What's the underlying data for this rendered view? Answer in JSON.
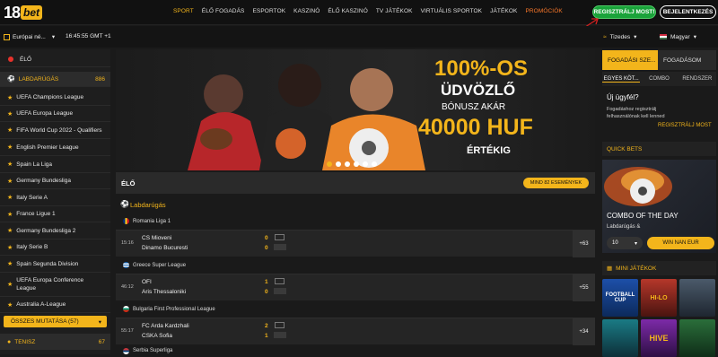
{
  "logo": {
    "number": "18",
    "brand": "bet"
  },
  "nav": {
    "items": [
      "SPORT",
      "ÉLŐ FOGADÁS",
      "ESPORTOK",
      "KASZINÓ",
      "ÉLŐ KASZINÓ",
      "TV JÁTÉKOK",
      "VIRTUÁLIS SPORTOK",
      "JÁTÉKOK",
      "PROMÓCIÓK"
    ],
    "active": "SPORT",
    "register": "REGISZTRÁLJ MOST!",
    "login": "BEJELENTKEZÉS"
  },
  "subbar": {
    "timezone": "Európai né...",
    "clock": "16:45:55 GMT +1",
    "odds_format": "Tizedes",
    "language": "Magyar"
  },
  "sidebar": {
    "live": "ÉLŐ",
    "football": {
      "label": "LABDARÚGÁS",
      "count": "886"
    },
    "leagues": [
      "UEFA Champions League",
      "UEFA Europa League",
      "FIFA World Cup 2022 - Qualifiers",
      "English Premier League",
      "Spain La Liga",
      "Germany Bundesliga",
      "Italy Serie A",
      "France Ligue 1",
      "Germany Bundesliga 2",
      "Italy Serie B",
      "Spain Segunda Division",
      "UEFA Europa Conference League",
      "Australia A-League"
    ],
    "show_all": "ÖSSZES MUTATÁSA (57)",
    "tennis": {
      "label": "TENISZ",
      "count": "67"
    }
  },
  "banner": {
    "line1": "100%-OS",
    "line2": "ÜDVÖZLŐ",
    "line3": "BÓNUSZ AKÁR",
    "line4": "40000 HUF",
    "line5": "ÉRTÉKIG"
  },
  "live": {
    "title": "ÉLŐ",
    "all_events": "MIND 82 ESEMÉNYEK",
    "sport": "Labdarúgás",
    "matches": [
      {
        "league": "Romania Liga 1",
        "time": "15:16",
        "home": "CS Mioveni",
        "away": "Dinamo Bucuresti",
        "home_score": "0",
        "away_score": "0",
        "markets": "+63"
      },
      {
        "league": "Greece Super League",
        "time": "46:12",
        "home": "OFI",
        "away": "Aris Thessaloniki",
        "home_score": "1",
        "away_score": "0",
        "markets": "+55"
      },
      {
        "league": "Bulgaria First Professional League",
        "time": "55:17",
        "home": "FC Arda Kardzhali",
        "away": "CSKA Sofia",
        "home_score": "2",
        "away_score": "1",
        "markets": "+34"
      }
    ],
    "next_league": "Serbia Superliga"
  },
  "right": {
    "tab_register": "FOGADÁSI SZE...",
    "tab_betslip": "FOGADÁSOM",
    "subtabs": [
      "EGYES KÖT...",
      "COMBO",
      "RENDSZER"
    ],
    "new_customer": "Új ügyfél?",
    "new_text": "Fogadáshoz regisztrálj felhasználónak kell lenned",
    "register_now": "REGISZTRÁLJ MOST",
    "quick_bets": "QUICK BETS",
    "combo_title": "COMBO OF THE DAY",
    "combo_sport": "Labdarúgás &",
    "stake": "10",
    "win_button": "WIN NAN EUR",
    "mini_games": "MINI JÁTÉKOK",
    "game_tiles": [
      "FOOTBALL CUP",
      "HI-LO",
      "",
      "",
      "HIVE",
      ""
    ]
  },
  "colors": {
    "accent": "#f3b51b",
    "green": "#1aa33a",
    "live": "#e8322b"
  }
}
